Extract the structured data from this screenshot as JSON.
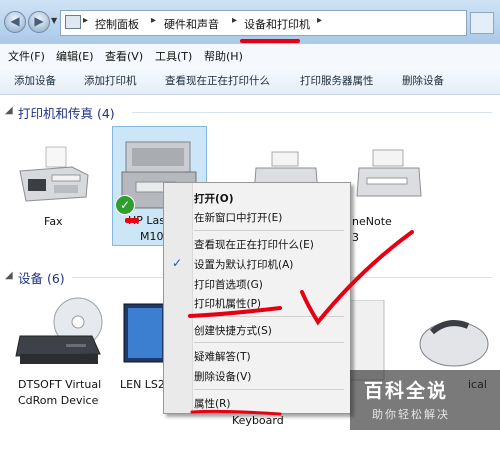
{
  "address_bar": {
    "crumbs": [
      "控制面板",
      "硬件和声音",
      "设备和打印机"
    ]
  },
  "menu": [
    "文件(F)",
    "编辑(E)",
    "查看(V)",
    "工具(T)",
    "帮助(H)"
  ],
  "commands": [
    "添加设备",
    "添加打印机",
    "查看现在正在打印什么",
    "打印服务器属性",
    "删除设备"
  ],
  "printers_group": {
    "title": "打印机和传真 (4)",
    "devices": [
      {
        "label": "Fax"
      },
      {
        "label_1": "HP Las",
        "label_2": "M10"
      },
      {
        "label": ""
      },
      {
        "label_1": "neNote",
        "label_2": "3"
      }
    ]
  },
  "devices_group": {
    "title": "设备 (6)",
    "devices": [
      {
        "label_1": "DTSOFT Virtual",
        "label_2": "CdRom Device"
      },
      {
        "label": "LEN LS2"
      },
      {
        "label": "Keyboard"
      },
      {
        "label": "ical"
      }
    ]
  },
  "context_menu": {
    "items": [
      "打开(O)",
      "在新窗口中打开(E)",
      "查看现在正在打印什么(E)",
      "设置为默认打印机(A)",
      "打印首选项(G)",
      "打印机属性(P)",
      "创建快捷方式(S)",
      "疑难解答(T)",
      "删除设备(V)",
      "属性(R)"
    ],
    "checked_index": 3
  },
  "watermark": {
    "title": "百科全说",
    "subtitle": "助你轻松解决"
  },
  "colors": {
    "annotation_red": "#e60012",
    "selection_blue": "#cde6f7",
    "group_title": "#1e3287"
  }
}
